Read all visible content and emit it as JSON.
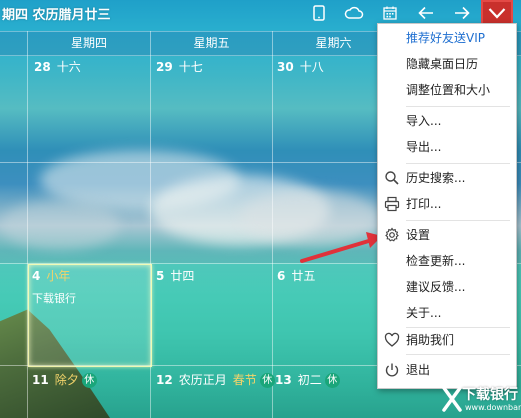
{
  "header": {
    "date_text": "期四 农历腊月廿三",
    "icons": [
      "phone-icon",
      "cloud-icon",
      "calendar-icon",
      "arrow-left-icon",
      "arrow-right-icon",
      "chevron-down-icon"
    ]
  },
  "weekdays": [
    "星期四",
    "星期五",
    "星期六"
  ],
  "weeks": [
    {
      "days": [
        {
          "num": "28",
          "lunar": "十六"
        },
        {
          "num": "29",
          "lunar": "十七"
        },
        {
          "num": "30",
          "lunar": "十八"
        }
      ]
    },
    {
      "days": [
        {
          "num": "4",
          "lunar": "小年",
          "event": "下载银行"
        },
        {
          "num": "5",
          "lunar": "廿四"
        },
        {
          "num": "6",
          "lunar": "廿五"
        }
      ]
    },
    {
      "days": [
        {
          "num": "11",
          "lunar": "除夕",
          "rest": "休"
        },
        {
          "num": "12",
          "lunar": "农历正月",
          "holiday": "春节",
          "rest": "休"
        },
        {
          "num": "13",
          "lunar": "初二",
          "rest": "休"
        }
      ]
    }
  ],
  "menu": {
    "items": [
      {
        "label": "推荐好友送VIP",
        "icon": ""
      },
      {
        "label": "隐藏桌面日历",
        "icon": ""
      },
      {
        "label": "调整位置和大小",
        "icon": ""
      },
      {
        "label": "导入...",
        "icon": ""
      },
      {
        "label": "导出...",
        "icon": ""
      },
      {
        "label": "历史搜索...",
        "icon": "search-icon"
      },
      {
        "label": "打印...",
        "icon": "printer-icon"
      },
      {
        "label": "设置",
        "icon": "gear-icon"
      },
      {
        "label": "检查更新...",
        "icon": ""
      },
      {
        "label": "建议反馈...",
        "icon": ""
      },
      {
        "label": "关于...",
        "icon": ""
      },
      {
        "label": "捐助我们",
        "icon": "heart-icon"
      },
      {
        "label": "退出",
        "icon": "power-icon"
      }
    ]
  },
  "watermark": {
    "name": "下载银行",
    "url": "www.downbank.cn"
  },
  "colors": {
    "menu_highlight": "#1f6fd0",
    "active_button": "#c9302c",
    "arrow": "#e0323a",
    "holiday": "#f2d36a",
    "rest_badge": "#1aa67a"
  }
}
